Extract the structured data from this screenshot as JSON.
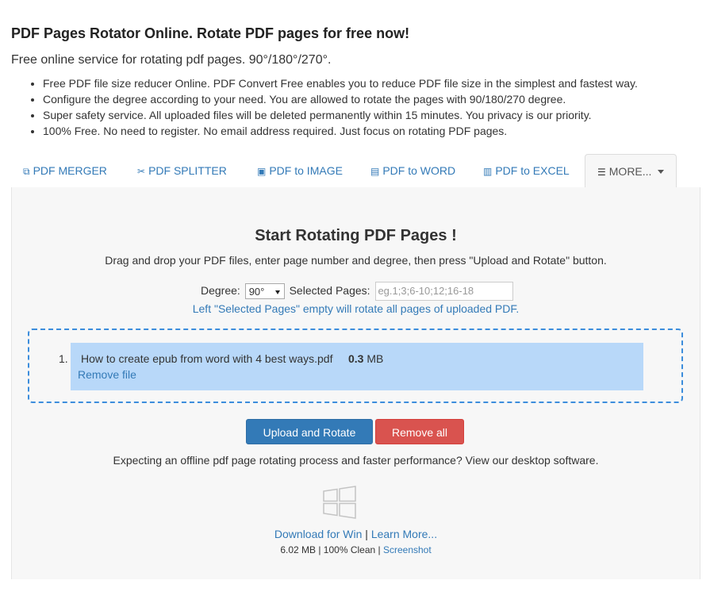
{
  "header": {
    "title": "PDF Pages Rotator Online. Rotate PDF pages for free now!",
    "subtitle": "Free online service for rotating pdf pages. 90°/180°/270°."
  },
  "features": [
    "Free PDF file size reducer Online. PDF Convert Free enables you to reduce PDF file size in the simplest and fastest way.",
    "Configure the degree according to your need. You are allowed to rotate the pages with 90/180/270 degree.",
    "Super safety service. All uploaded files will be deleted permanently within 15 minutes. You privacy is our priority.",
    "100% Free. No need to register. No email address required. Just focus on rotating PDF pages."
  ],
  "tabs": {
    "merger": "PDF MERGER",
    "splitter": "PDF SPLITTER",
    "image": "PDF to IMAGE",
    "word": "PDF to WORD",
    "excel": "PDF to EXCEL",
    "more": "MORE..."
  },
  "tool": {
    "heading": "Start Rotating PDF Pages !",
    "description": "Drag and drop your PDF files, enter page number and degree, then press \"Upload and Rotate\" button.",
    "degree_label": "Degree:",
    "degree_value": "90°",
    "pages_label": "Selected Pages:",
    "pages_placeholder": "eg.1;3;6-10;12;16-18",
    "hint": "Left \"Selected Pages\" empty will rotate all pages of uploaded PDF."
  },
  "files": [
    {
      "index": "1.",
      "name": "How to create epub from word with 4 best ways.pdf",
      "size_value": "0.3",
      "size_unit": "MB",
      "remove_label": "Remove file"
    }
  ],
  "actions": {
    "upload_label": "Upload and Rotate",
    "remove_all_label": "Remove all"
  },
  "desktop": {
    "promo": "Expecting an offline pdf page rotating process and faster performance? View our desktop software.",
    "download_label": "Download for Win",
    "separator": " | ",
    "learn_more_label": "Learn More...",
    "meta_text": "6.02 MB | 100% Clean | ",
    "screenshot_label": "Screenshot"
  },
  "colors": {
    "link": "#337ab7",
    "primary_button": "#337ab7",
    "danger_button": "#d9534f",
    "file_row": "#b8d8f9",
    "dropzone_border": "#3c8ddc"
  }
}
